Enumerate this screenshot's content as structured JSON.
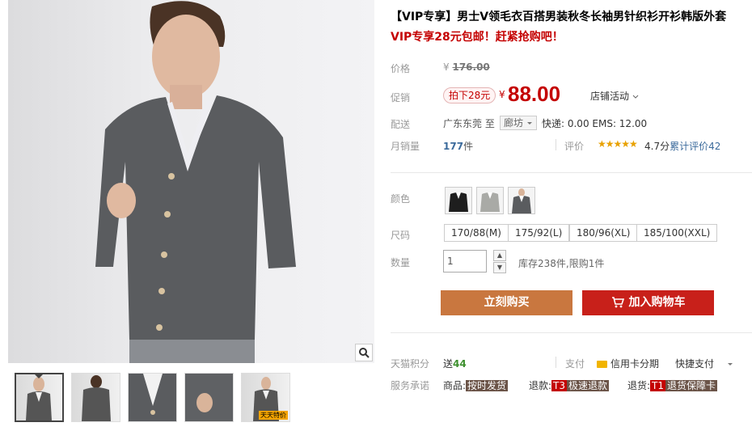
{
  "product": {
    "title": "【VIP专享】男士V领毛衣百搭男装秋冬长袖男针织衫开衫韩版外套",
    "promo": "VIP专享28元包邮！赶紧抢购吧！"
  },
  "price_block": {
    "price_label": "价格",
    "currency_symbol": "¥",
    "original_price": "176.00",
    "promo_label": "促销",
    "discount_badge": "拍下28元",
    "current_price": "88.00",
    "store_activity": "店铺活动"
  },
  "shipping": {
    "label": "配送",
    "from": "广东东莞",
    "to_word": "至",
    "destination": "廊坊",
    "fees": "快递: 0.00 EMS: 12.00"
  },
  "sales": {
    "label": "月销量",
    "count": "177",
    "unit": "件",
    "rating_label": "评价",
    "stars": "★★★★★",
    "score": "4.7分",
    "cumulative_label": "累计评价",
    "cumulative_count": "42"
  },
  "options": {
    "color_label": "颜色",
    "size_label": "尺码",
    "sizes": [
      "170/88(M)",
      "175/92(L)",
      "180/96(XL)",
      "185/100(XXL)"
    ],
    "qty_label": "数量",
    "qty_value": "1",
    "stock_text": "库存238件,限购1件"
  },
  "actions": {
    "buy_now": "立刻购买",
    "add_to_cart": "加入购物车"
  },
  "footer": {
    "points_label": "天猫积分",
    "points_prefix": "送",
    "points_value": "44",
    "payment_label": "支付",
    "credit_card": "信用卡分期",
    "quick_pay": "快捷支付",
    "service_label": "服务承诺",
    "goods_label": "商品:",
    "goods_tag": "按时发货",
    "refund_label": "退款:",
    "refund_t3": "T3",
    "refund_tag": "极速退款",
    "return_label": "退货:",
    "return_t1": "T1",
    "return_tag": "退货保障卡"
  },
  "thumbnails": [
    {
      "name": "model-front-full"
    },
    {
      "name": "model-back"
    },
    {
      "name": "collar-closeup"
    },
    {
      "name": "cuff-closeup"
    },
    {
      "name": "model-with-badge",
      "badge": "天天特价"
    }
  ],
  "colors": {
    "accent_red": "#c40000",
    "buy_orange": "#c9773f",
    "cart_red": "#c8201a",
    "link_blue": "#3c6b9c",
    "star_gold": "#e8a100",
    "sweater_gray": "#5a5c5f"
  },
  "icons": [
    "zoom-icon",
    "cart-icon",
    "chevron-down-icon",
    "credit-card-icon",
    "spin-up-icon",
    "spin-down-icon"
  ]
}
